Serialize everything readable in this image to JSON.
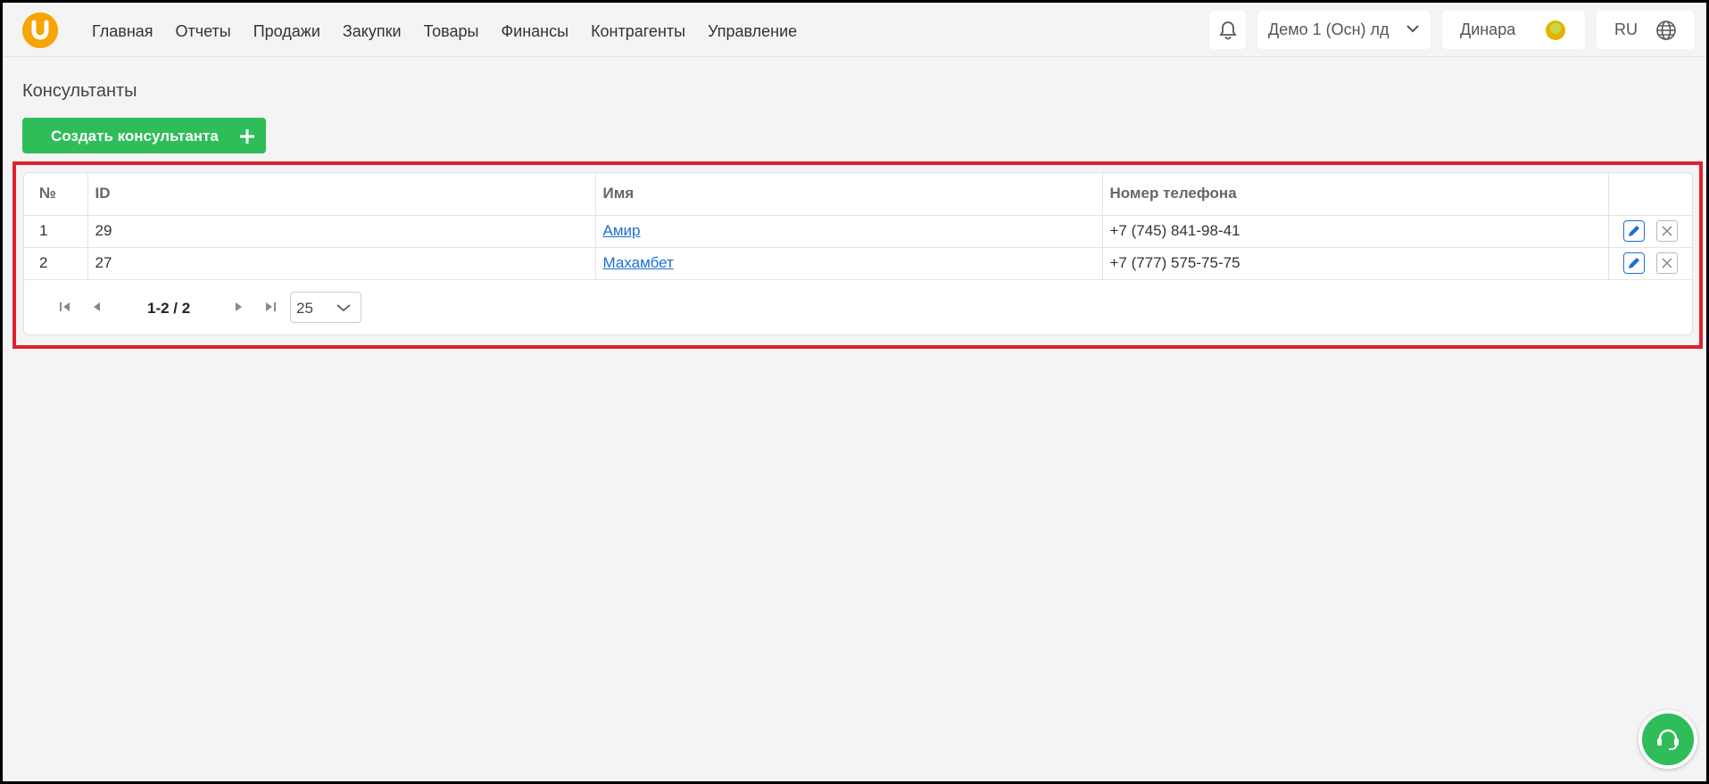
{
  "header": {
    "logo_letter": "U",
    "nav": [
      "Главная",
      "Отчеты",
      "Продажи",
      "Закупки",
      "Товары",
      "Финансы",
      "Контрагенты",
      "Управление"
    ],
    "organization": "Демо 1 (Осн) лд",
    "user": "Динара",
    "language": "RU"
  },
  "page": {
    "title": "Консультанты",
    "create_button": "Создать консультанта"
  },
  "table": {
    "columns": [
      "№",
      "ID",
      "Имя",
      "Номер телефона"
    ],
    "rows": [
      {
        "num": "1",
        "id": "29",
        "name": "Амир",
        "phone": "+7 (745) 841-98-41"
      },
      {
        "num": "2",
        "id": "27",
        "name": "Махамбет",
        "phone": "+7 (777) 575-75-75"
      }
    ]
  },
  "pagination": {
    "info": "1-2 / 2",
    "page_size": "25"
  },
  "colors": {
    "accent_green": "#2ebd59",
    "logo_orange": "#f6a400",
    "link_blue": "#1a6fd6",
    "highlight_red": "#e0202e"
  }
}
